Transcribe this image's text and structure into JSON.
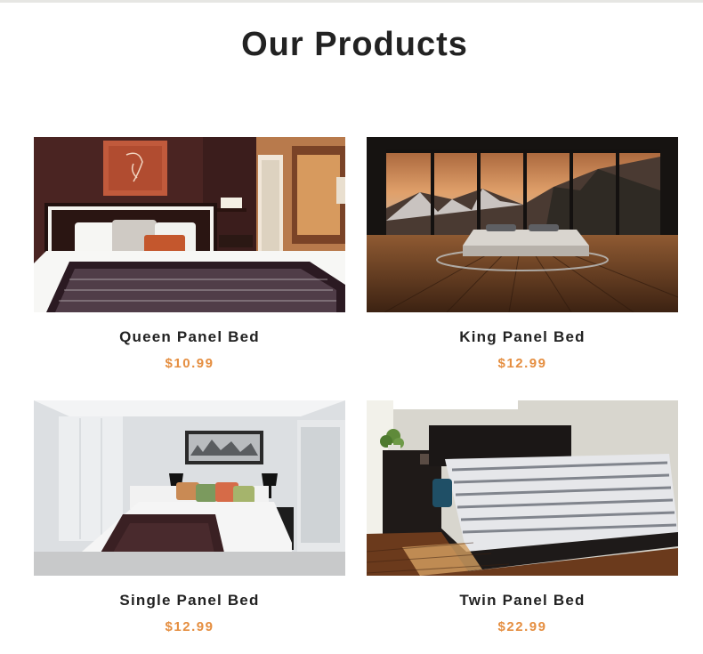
{
  "section": {
    "title": "Our Products"
  },
  "products": [
    {
      "name": "Queen Panel Bed",
      "price": "$10.99",
      "image": "bedroom-photo-queen-bed"
    },
    {
      "name": "King Panel Bed",
      "price": "$12.99",
      "image": "bedroom-photo-king-bed"
    },
    {
      "name": "Single Panel Bed",
      "price": "$12.99",
      "image": "bedroom-photo-single-bed"
    },
    {
      "name": "Twin Panel Bed",
      "price": "$22.99",
      "image": "bedroom-photo-twin-bed"
    }
  ],
  "colors": {
    "price": "#e58e40",
    "text": "#222222",
    "background": "#ffffff"
  }
}
